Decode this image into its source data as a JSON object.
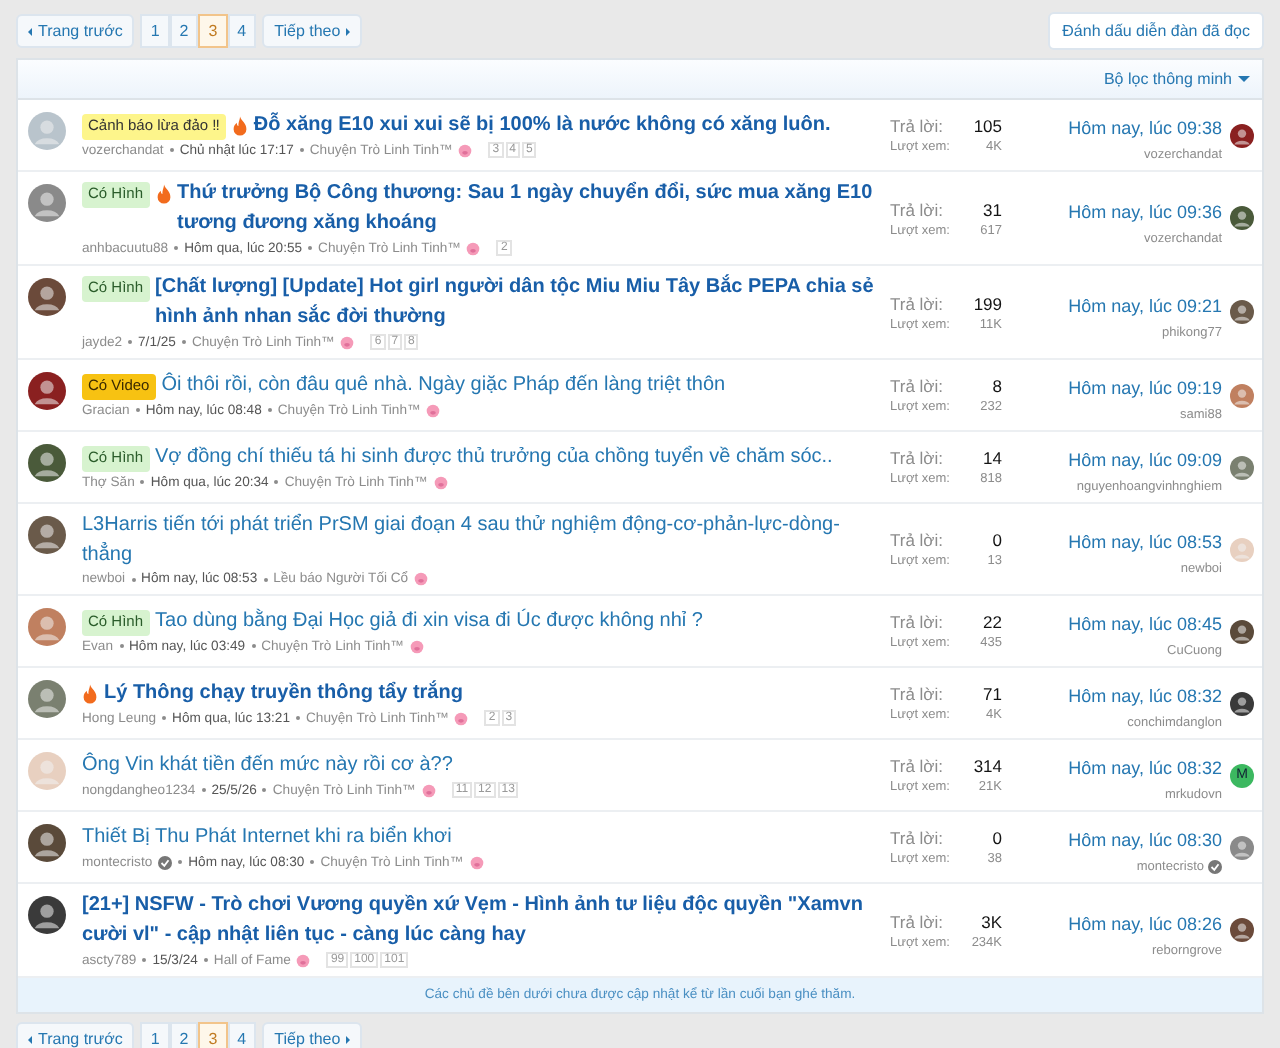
{
  "pagination_top": {
    "prev": "Trang trước",
    "next": "Tiếp theo",
    "pages": [
      {
        "label": "1",
        "selected": false
      },
      {
        "label": "2",
        "selected": false
      },
      {
        "label": "3",
        "selected": true
      },
      {
        "label": "4",
        "selected": false
      }
    ]
  },
  "mark_read": "Đánh dấu diễn đàn đã đọc",
  "filter": "Bộ lọc thông minh",
  "threads": [
    {
      "prefix": {
        "kind": "warning",
        "label": "Cảnh báo lừa đảo ‼"
      },
      "hot": true,
      "bold": true,
      "title": "Đỗ xăng E10 xui xui sẽ bị 100% là nước không có xăng luôn.",
      "author": "vozerchandat",
      "author_verified": false,
      "date": "Chủ nhật lúc 17:17",
      "forum": "Chuyện Trò Linh Tinh™",
      "pages": [
        "3",
        "4",
        "5"
      ],
      "replies_label": "Trả lời:",
      "replies": "105",
      "views_label": "Lượt xem:",
      "views": "4K",
      "last_time": "Hôm nay, lúc 09:38",
      "last_user": "vozerchandat",
      "last_user_verified": false
    },
    {
      "prefix": {
        "kind": "image",
        "label": "Có Hình"
      },
      "hot": true,
      "bold": true,
      "title": "Thứ trưởng Bộ Công thương: Sau 1 ngày chuyển đổi, sức mua xăng E10 tương đương xăng khoáng",
      "author": "anhbacuutu88",
      "author_verified": false,
      "date": "Hôm qua, lúc 20:55",
      "forum": "Chuyện Trò Linh Tinh™",
      "pages": [
        "2"
      ],
      "replies_label": "Trả lời:",
      "replies": "31",
      "views_label": "Lượt xem:",
      "views": "617",
      "last_time": "Hôm nay, lúc 09:36",
      "last_user": "vozerchandat",
      "last_user_verified": false
    },
    {
      "prefix": {
        "kind": "image",
        "label": "Có Hình"
      },
      "hot": false,
      "bold": true,
      "title": "[Chất lượng] [Update] Hot girl người dân tộc Miu Miu Tây Bắc PEPA chia sẻ hình ảnh nhan sắc đời thường",
      "author": "jayde2",
      "author_verified": false,
      "date": "7/1/25",
      "forum": "Chuyện Trò Linh Tinh™",
      "pages": [
        "6",
        "7",
        "8"
      ],
      "replies_label": "Trả lời:",
      "replies": "199",
      "views_label": "Lượt xem:",
      "views": "11K",
      "last_time": "Hôm nay, lúc 09:21",
      "last_user": "phikong77",
      "last_user_verified": false
    },
    {
      "prefix": {
        "kind": "video",
        "label": "Có Video"
      },
      "hot": false,
      "bold": false,
      "title": "Ôi thôi rồi, còn đâu quê nhà. Ngày giặc Pháp đến làng triệt thôn",
      "author": "Gracian",
      "author_verified": false,
      "date": "Hôm nay, lúc 08:48",
      "forum": "Chuyện Trò Linh Tinh™",
      "replies_label": "Trả lời:",
      "replies": "8",
      "views_label": "Lượt xem:",
      "views": "232",
      "last_time": "Hôm nay, lúc 09:19",
      "last_user": "sami88",
      "last_user_verified": false
    },
    {
      "prefix": {
        "kind": "image",
        "label": "Có Hình"
      },
      "hot": false,
      "bold": false,
      "title": "Vợ đồng chí thiếu tá hi sinh được thủ trưởng của chồng tuyển về chăm sóc..",
      "author": "Thợ Săn",
      "author_verified": false,
      "date": "Hôm qua, lúc 20:34",
      "forum": "Chuyện Trò Linh Tinh™",
      "replies_label": "Trả lời:",
      "replies": "14",
      "views_label": "Lượt xem:",
      "views": "818",
      "last_time": "Hôm nay, lúc 09:09",
      "last_user": "nguyenhoangvinhnghiem",
      "last_user_verified": false
    },
    {
      "hot": false,
      "bold": false,
      "title": "L3Harris tiến tới phát triển PrSM giai đoạn 4 sau thử nghiệm động-cơ-phản-lực-dòng-thẳng",
      "author": "newboi",
      "author_verified": false,
      "date": "Hôm nay, lúc 08:53",
      "forum": "Lều báo Người Tối Cổ",
      "replies_label": "Trả lời:",
      "replies": "0",
      "views_label": "Lượt xem:",
      "views": "13",
      "last_time": "Hôm nay, lúc 08:53",
      "last_user": "newboi",
      "last_user_verified": false
    },
    {
      "prefix": {
        "kind": "image",
        "label": "Có Hình"
      },
      "hot": false,
      "bold": false,
      "title": "Tao dùng bằng Đại Học giả đi xin visa đi Úc được không nhỉ ?",
      "author": "Evan",
      "author_verified": false,
      "date": "Hôm nay, lúc 03:49",
      "forum": "Chuyện Trò Linh Tinh™",
      "replies_label": "Trả lời:",
      "replies": "22",
      "views_label": "Lượt xem:",
      "views": "435",
      "last_time": "Hôm nay, lúc 08:45",
      "last_user": "CuCuong",
      "last_user_verified": false
    },
    {
      "hot": true,
      "bold": true,
      "title": "Lý Thông chạy truyền thông tẩy trắng",
      "author": "Hong Leung",
      "author_verified": false,
      "date": "Hôm qua, lúc 13:21",
      "forum": "Chuyện Trò Linh Tinh™",
      "pages": [
        "2",
        "3"
      ],
      "replies_label": "Trả lời:",
      "replies": "71",
      "views_label": "Lượt xem:",
      "views": "4K",
      "last_time": "Hôm nay, lúc 08:32",
      "last_user": "conchimdanglon",
      "last_user_verified": false
    },
    {
      "hot": false,
      "bold": false,
      "title": "Ông Vin khát tiền đến mức này rồi cơ à??",
      "author": "nongdangheo1234",
      "author_verified": false,
      "date": "25/5/26",
      "forum": "Chuyện Trò Linh Tinh™",
      "pages": [
        "11",
        "12",
        "13"
      ],
      "replies_label": "Trả lời:",
      "replies": "314",
      "views_label": "Lượt xem:",
      "views": "21K",
      "last_time": "Hôm nay, lúc 08:32",
      "last_user": "mrkudovn",
      "last_user_verified": false,
      "last_avatar_letter": "M"
    },
    {
      "hot": false,
      "bold": false,
      "title": "Thiết Bị Thu Phát Internet khi ra biển khơi",
      "author": "montecristo",
      "author_verified": true,
      "date": "Hôm nay, lúc 08:30",
      "forum": "Chuyện Trò Linh Tinh™",
      "replies_label": "Trả lời:",
      "replies": "0",
      "views_label": "Lượt xem:",
      "views": "38",
      "last_time": "Hôm nay, lúc 08:30",
      "last_user": "montecristo",
      "last_user_verified": true
    },
    {
      "hot": false,
      "bold": true,
      "title": "[21+] NSFW - Trò chơi Vương quyền xứ Vẹm - Hình ảnh tư liệu độc quyền \"Xamvn cười vl\" - cập nhật liên tục - càng lúc càng hay",
      "author": "ascty789",
      "author_verified": false,
      "date": "15/3/24",
      "forum": "Hall of Fame",
      "pages": [
        "99",
        "100",
        "101"
      ],
      "replies_label": "Trả lời:",
      "replies": "3K",
      "views_label": "Lượt xem:",
      "views": "234K",
      "last_time": "Hôm nay, lúc 08:26",
      "last_user": "reborngrove",
      "last_user_verified": false
    }
  ],
  "notice": "Các chủ đề bên dưới chưa được cập nhật kể từ lần cuối bạn ghé thăm.",
  "pagination_bottom": {
    "prev": "Trang trước",
    "next": "Tiếp theo",
    "pages": [
      {
        "label": "1",
        "selected": false
      },
      {
        "label": "2",
        "selected": false
      },
      {
        "label": "3",
        "selected": true
      },
      {
        "label": "4",
        "selected": false
      }
    ]
  }
}
